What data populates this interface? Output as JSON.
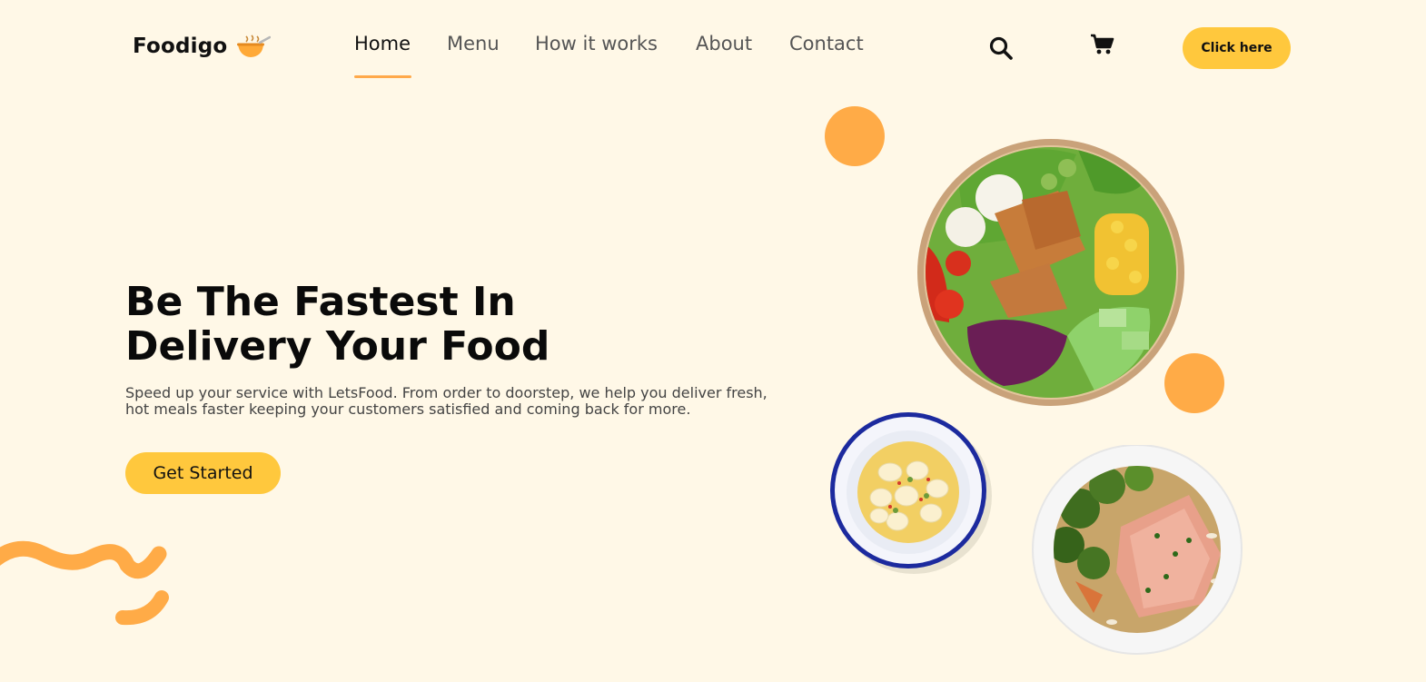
{
  "brand": {
    "name": "Foodigo",
    "icon": "soup-bowl-icon"
  },
  "nav": {
    "items": [
      {
        "label": "Home",
        "active": true
      },
      {
        "label": "Menu",
        "active": false
      },
      {
        "label": "How it works",
        "active": false
      },
      {
        "label": "About",
        "active": false
      },
      {
        "label": "Contact",
        "active": false
      }
    ]
  },
  "header": {
    "search_icon": "search-icon",
    "cart_icon": "cart-icon",
    "cta_label": "Click here"
  },
  "hero": {
    "title_line1": "Be The Fastest In",
    "title_line2": "Delivery Your Food",
    "description": "Speed up your service with LetsFood. From order to doorstep, we help you deliver fresh, hot meals faster keeping your customers satisfied and coming back for more.",
    "cta_label": "Get Started"
  },
  "images": [
    {
      "name": "salad-bowl-image"
    },
    {
      "name": "soup-plate-image"
    },
    {
      "name": "salmon-plate-image"
    }
  ],
  "colors": {
    "background": "#fff8e7",
    "accent_yellow": "#ffc83d",
    "accent_orange": "#ffab47",
    "text_dark": "#111111",
    "text_muted": "#555555"
  }
}
